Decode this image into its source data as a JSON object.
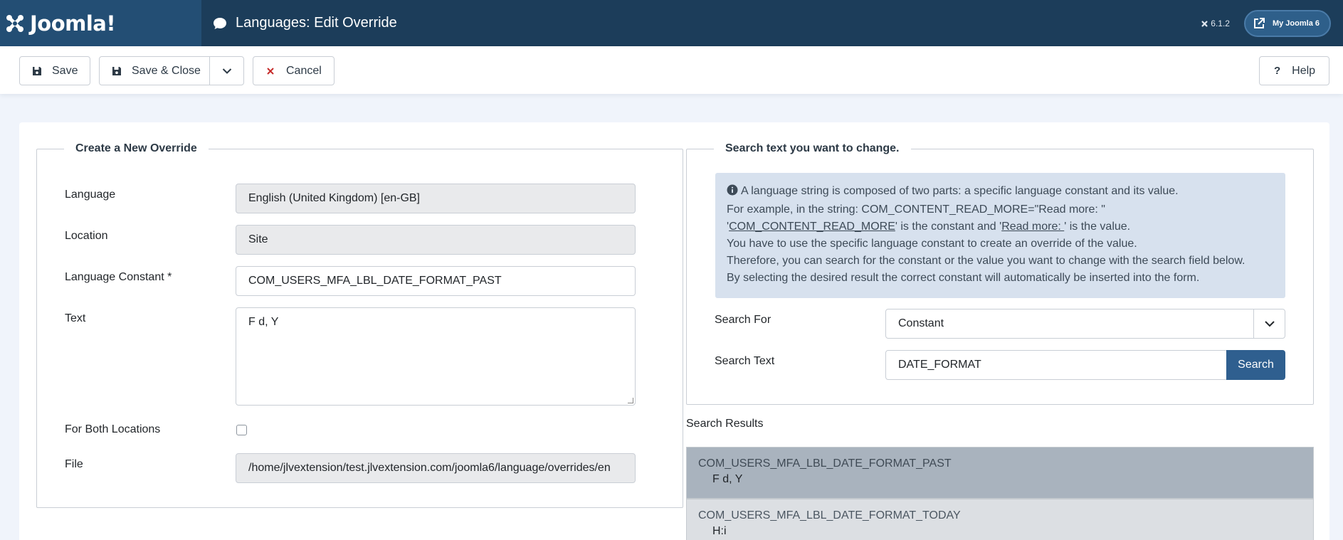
{
  "header": {
    "brand": "Joomla!",
    "title": "Languages: Edit Override",
    "version": "6.1.2",
    "my_joomla": "My Joomla 6"
  },
  "toolbar": {
    "save": "Save",
    "save_close": "Save & Close",
    "cancel": "Cancel",
    "help": "Help"
  },
  "left": {
    "legend": "Create a New Override",
    "language_label": "Language",
    "language_value": "English (United Kingdom) [en-GB]",
    "location_label": "Location",
    "location_value": "Site",
    "constant_label": "Language Constant *",
    "constant_value": "COM_USERS_MFA_LBL_DATE_FORMAT_PAST",
    "text_label": "Text",
    "text_value": "F d, Y",
    "both_label": "For Both Locations",
    "file_label": "File",
    "file_value": "/home/jlvextension/test.jlvextension.com/joomla6/language/overrides/en"
  },
  "right": {
    "legend": "Search text you want to change.",
    "info": {
      "line1": "A language string is composed of two parts: a specific language constant and its value.",
      "line2": "For example, in the string: COM_CONTENT_READ_MORE=\"Read more: \"",
      "line3_pre": "'",
      "line3_const": "COM_CONTENT_READ_MORE",
      "line3_mid": "' is the constant and '",
      "line3_val": "Read more: ",
      "line3_post": "' is the value.",
      "line4": "You have to use the specific language constant to create an override of the value.",
      "line5": "Therefore, you can search for the constant or the value you want to change with the search field below.",
      "line6": "By selecting the desired result the correct constant will automatically be inserted into the form."
    },
    "search_for_label": "Search For",
    "search_for_value": "Constant",
    "search_text_label": "Search Text",
    "search_text_value": "DATE_FORMAT",
    "search_button": "Search",
    "results_label": "Search Results",
    "results": [
      {
        "constant": "COM_USERS_MFA_LBL_DATE_FORMAT_PAST",
        "value": "F d, Y"
      },
      {
        "constant": "COM_USERS_MFA_LBL_DATE_FORMAT_TODAY",
        "value": "H:i"
      }
    ]
  },
  "colors": {
    "header_bg": "#1c3d5a",
    "brand_bg": "#234e74",
    "primary_button": "#2f5f8f",
    "info_bg": "#d7e1ee",
    "active_result": "#a9b3be"
  }
}
